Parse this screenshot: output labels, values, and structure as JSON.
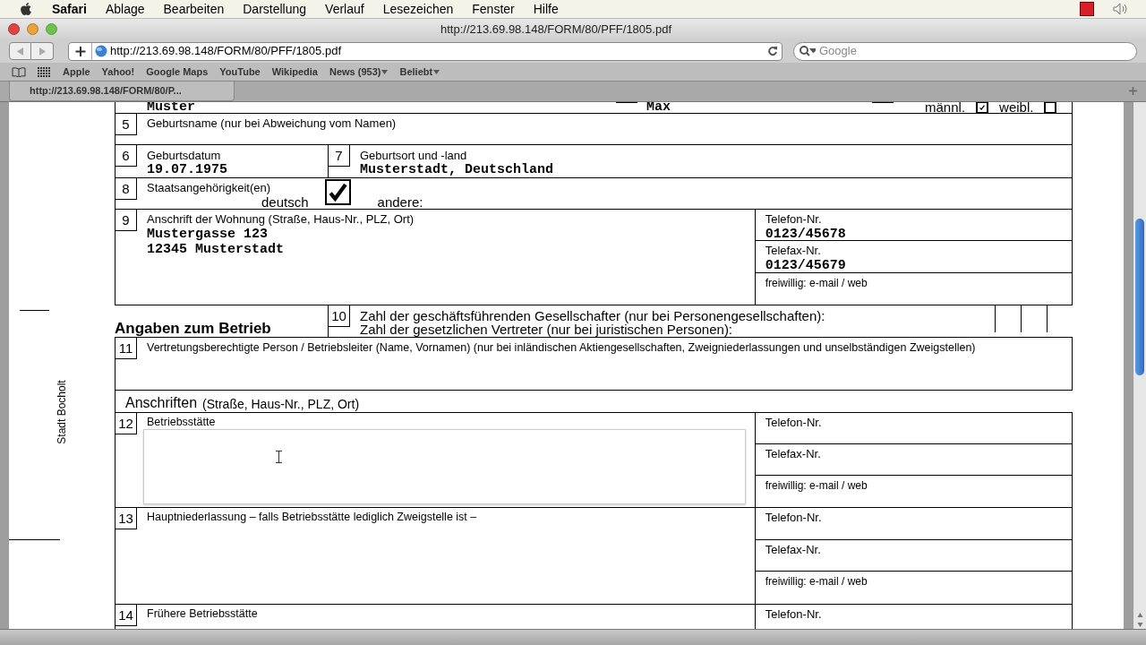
{
  "menubar": {
    "app": "Safari",
    "items": [
      "Ablage",
      "Bearbeiten",
      "Darstellung",
      "Verlauf",
      "Lesezeichen",
      "Fenster",
      "Hilfe"
    ]
  },
  "window": {
    "title": "http://213.69.98.148/FORM/80/PFF/1805.pdf"
  },
  "address": {
    "value": "http://213.69.98.148/FORM/80/PFF/1805.pdf"
  },
  "search": {
    "placeholder": "Google"
  },
  "bookmarks": [
    {
      "label": "Apple",
      "menu": false
    },
    {
      "label": "Yahoo!",
      "menu": false
    },
    {
      "label": "Google Maps",
      "menu": false
    },
    {
      "label": "YouTube",
      "menu": false
    },
    {
      "label": "Wikipedia",
      "menu": false
    },
    {
      "label": "News (953)",
      "menu": true
    },
    {
      "label": "Beliebt",
      "menu": true
    }
  ],
  "tab": {
    "title": "http://213.69.98.148/FORM/80/P..."
  },
  "margin_label": "Stadt Bocholt",
  "form": {
    "top_row": {
      "surname": "Muster",
      "first_name": "Max",
      "male_label": "männl.",
      "male": true,
      "female_label": "weibl.",
      "female": false
    },
    "field5": {
      "number": "5",
      "label": "Geburtsname (nur bei Abweichung vom Namen)"
    },
    "field6": {
      "number": "6",
      "label": "Geburtsdatum",
      "value": "19.07.1975"
    },
    "field7": {
      "number": "7",
      "label": "Geburtsort und -land",
      "value": "Musterstadt, Deutschland"
    },
    "field8": {
      "number": "8",
      "label": "Staatsangehörigkeit(en)",
      "german_label": "deutsch",
      "german": true,
      "other_label": "andere:"
    },
    "field9": {
      "number": "9",
      "label": "Anschrift der Wohnung (Straße, Haus-Nr., PLZ, Ort)",
      "lines": [
        "Mustergasse 123",
        "12345 Musterstadt"
      ],
      "contacts": [
        {
          "label": "Telefon-Nr.",
          "value": "0123/45678"
        },
        {
          "label": "Telefax-Nr.",
          "value": "0123/45679"
        },
        {
          "label": "freiwillig: e-mail / web"
        }
      ]
    },
    "section_title": "Angaben zum Betrieb",
    "field10": {
      "number": "10",
      "lines": [
        "Zahl der geschäftsführenden Gesellschafter (nur bei Personengesellschaften):",
        "Zahl der gesetzlichen Vertreter (nur bei juristischen Personen):"
      ]
    },
    "field11": {
      "number": "11",
      "label": "Vertretungsberechtigte Person / Betriebsleiter (Name, Vornamen) (nur bei inländischen Aktiengesellschaften, Zweigniederlassungen und unselbständigen Zweigstellen)"
    },
    "addresses_title": "Anschriften",
    "addresses_hint": "(Straße, Haus-Nr., PLZ, Ort)",
    "address_fields": [
      {
        "number": "12",
        "label": "Betriebsstätte",
        "contacts": [
          {
            "label": "Telefon-Nr."
          },
          {
            "label": "Telefax-Nr."
          },
          {
            "label": "freiwillig: e-mail / web"
          }
        ]
      },
      {
        "number": "13",
        "label": "Hauptniederlassung – falls Betriebsstätte lediglich Zweigstelle ist –",
        "contacts": [
          {
            "label": "Telefon-Nr."
          },
          {
            "label": "Telefax-Nr."
          },
          {
            "label": "freiwillig: e-mail / web"
          }
        ]
      },
      {
        "number": "14",
        "label": "Frühere Betriebsstätte",
        "contacts": [
          {
            "label": "Telefon-Nr."
          }
        ]
      }
    ]
  }
}
